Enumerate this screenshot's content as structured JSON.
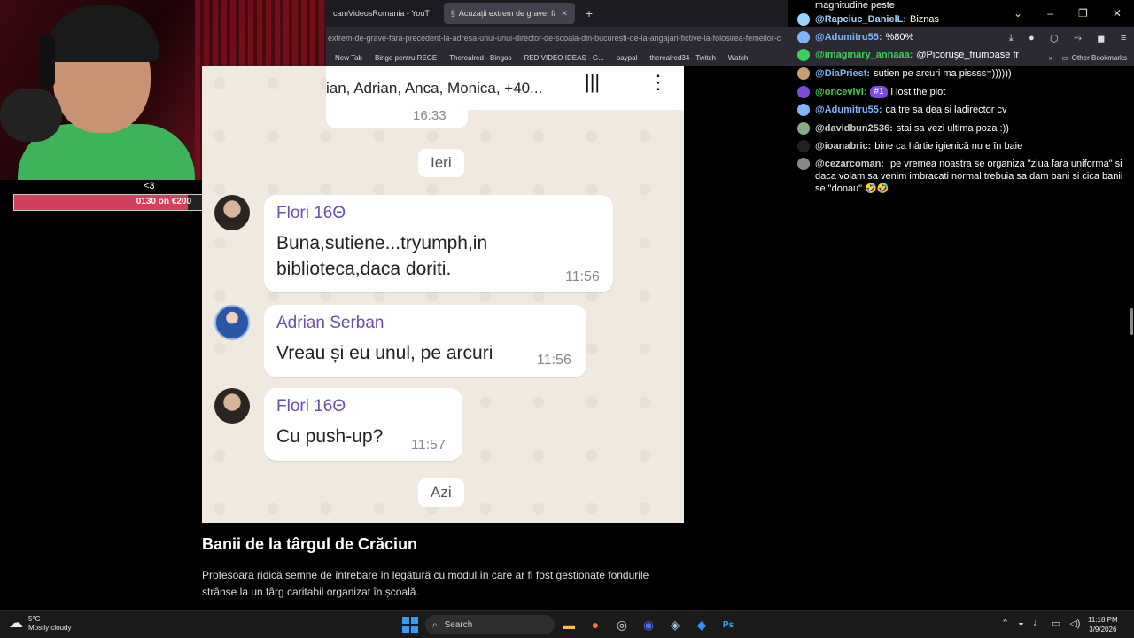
{
  "browser": {
    "tabs": [
      {
        "label": "camVideosRomania - YouT",
        "active": false
      },
      {
        "label": "Acuzații extrem de grave, fără p",
        "active": true
      }
    ],
    "new_tab_symbol": "+",
    "url": "extrem-de-grave-fara-precedent-la-adresa-unui-unui-director-de-scoala-din-bucuresti-de-la-angajari-fictive-la-folosirea-femeilor-c",
    "bookmarks": [
      "New Tab",
      "Bingo pentru REGE",
      "Therealred - Bingos",
      "RED VIDEO IDEAS - G...",
      "paypal",
      "therealred34 - Twitch",
      "Watch"
    ],
    "other_bookmarks": "Other Bookmarks"
  },
  "overlay": {
    "heart": "<3",
    "goal_text": "0130 on €200",
    "goal_fraction": 0.65
  },
  "chat_screenshot": {
    "members": "ian, Adrian, Anca, Monica, +40...",
    "prev_time": "16:33",
    "day_yesterday": "Ieri",
    "day_today": "Azi",
    "messages": [
      {
        "name": "Flori 16Θ",
        "line1": "Buna,sutiene...tryumph,in",
        "line2": "biblioteca,daca doriti.",
        "time": "11:56"
      },
      {
        "name": "Adrian Serban",
        "line1": "Vreau și eu unul, pe arcuri",
        "time": "11:56"
      },
      {
        "name": "Flori 16Θ",
        "line1": "Cu push-up?",
        "time": "11:57"
      }
    ]
  },
  "article": {
    "title": "Banii de la târgul de Crăciun",
    "body": "Profesoara ridică semne de întrebare în legătură cu modul în care ar fi fost gestionate fondurile strânse la un târg caritabil organizat în școală."
  },
  "twitch_chat": {
    "top_line": "magnitudine peste",
    "messages": [
      {
        "user": "@Rapciuc_DanielL:",
        "text": "Biznas",
        "color": "#9fd3ff"
      },
      {
        "user": "@Adumitru55:",
        "text": "%80%",
        "color": "#7fb5ff"
      },
      {
        "user": "@imaginary_annaaa:",
        "text": "@Picoruşe_frumoase fr",
        "color": "#3ccf5a"
      },
      {
        "user": "@DiaPriest:",
        "text": "sutien pe arcuri ma pissss=))))))",
        "color": "#7fb5ff"
      },
      {
        "user": "@oncevivi:",
        "badge": "#1",
        "text": "i lost the plot",
        "color": "#3ccf5a"
      },
      {
        "user": "@Adumitru55:",
        "text": "ca tre sa dea si ladirector cv",
        "color": "#7fb5ff"
      },
      {
        "user": "@davidbun2536:",
        "text": "stai sa vezi ultima poza :))",
        "color": "#cfcfcf"
      },
      {
        "user": "@ioanabric:",
        "text": "bine ca hârtie igienică nu e în baie",
        "color": "#cfcfcf"
      },
      {
        "user": "@cezarcoman:",
        "text": "pe vremea noastra se organiza \"ziua fara uniforma\" si daca voiam sa venim imbracati normal trebuia sa dam bani si cica banii se \"donau\" 🤣🤣",
        "color": "#cfcfcf"
      }
    ]
  },
  "taskbar": {
    "temp": "5°C",
    "weather": "Mostly cloudy",
    "search": "Search",
    "time": "11:18 PM",
    "date": "3/9/2026"
  }
}
